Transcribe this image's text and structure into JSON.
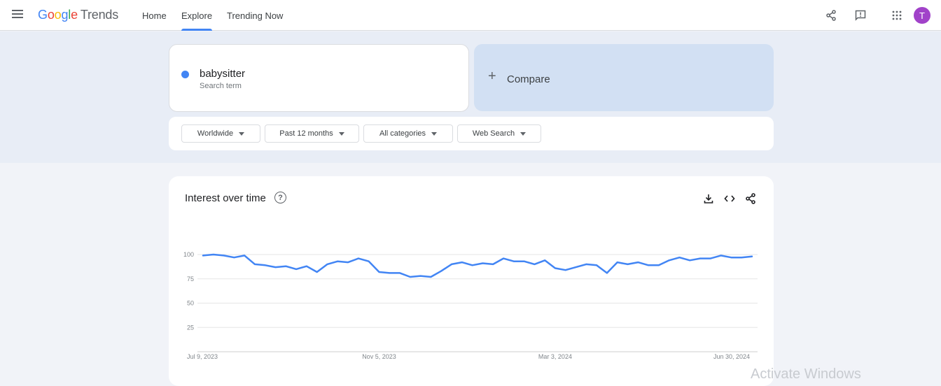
{
  "topbar": {
    "menu_icon": "hamburger-menu-icon",
    "logo_google": [
      "G",
      "o",
      "o",
      "g",
      "l",
      "e"
    ],
    "logo_trends": "Trends",
    "nav": [
      {
        "label": "Home",
        "active": false
      },
      {
        "label": "Explore",
        "active": true
      },
      {
        "label": "Trending Now",
        "active": false
      }
    ],
    "icons": [
      "share-icon",
      "feedback-icon",
      "apps-grid-icon"
    ],
    "avatar_initial": "T",
    "avatar_color": "#a142c9"
  },
  "search": {
    "term": "babysitter",
    "term_sub": "Search term",
    "term_color": "#4285f4",
    "compare_plus": "+",
    "compare_label": "Compare"
  },
  "filters": [
    {
      "label": "Worldwide"
    },
    {
      "label": "Past 12 months"
    },
    {
      "label": "All categories"
    },
    {
      "label": "Web Search"
    }
  ],
  "card": {
    "title": "Interest over time",
    "help": "?",
    "icons": [
      "download-icon",
      "embed-code-icon",
      "share-icon"
    ]
  },
  "watermark": "Activate Windows",
  "chart_data": {
    "type": "line",
    "title": "Interest over time",
    "xlabel": "",
    "ylabel": "",
    "ylim": [
      0,
      100
    ],
    "yticks": [
      25,
      50,
      75,
      100
    ],
    "xtick_labels": [
      "Jul 9, 2023",
      "Nov 5, 2023",
      "Mar 3, 2024",
      "Jun 30, 2024"
    ],
    "xtick_indices": [
      0,
      17,
      34,
      51
    ],
    "grid": true,
    "series": [
      {
        "name": "babysitter",
        "color": "#4285f4",
        "values": [
          99,
          100,
          99,
          97,
          99,
          90,
          89,
          87,
          88,
          85,
          88,
          82,
          90,
          93,
          92,
          96,
          93,
          82,
          81,
          81,
          77,
          78,
          77,
          83,
          90,
          92,
          89,
          91,
          90,
          96,
          93,
          93,
          90,
          94,
          86,
          84,
          87,
          90,
          89,
          81,
          92,
          90,
          92,
          89,
          89,
          94,
          97,
          94,
          96,
          96,
          99,
          97,
          97,
          98
        ]
      }
    ]
  }
}
